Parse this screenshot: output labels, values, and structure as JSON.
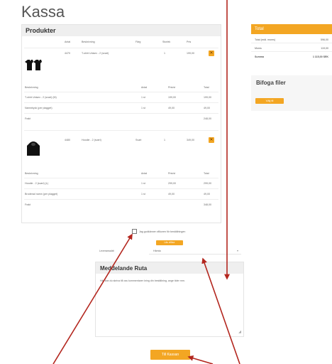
{
  "page": {
    "title": "Kassa"
  },
  "products": {
    "title": "Produkter",
    "headers": [
      "Antal",
      "Beskrivning",
      "Färg",
      "Storlek",
      "Pris"
    ],
    "items": [
      {
        "thumb": "tshirts-icon",
        "row": [
          "4470",
          "T-shirt Unisex - 2 (svart)",
          "",
          "1",
          "199,00"
        ],
        "sub_headers": [
          "Beskrivning",
          "Antal",
          "Pris/st",
          "Total"
        ],
        "sub_rows": [
          [
            "T-shirt Unisex - 2 (svart) (M)",
            "1 st",
            "199,00",
            "199,00"
          ],
          [
            "Namntryck (per plagget)",
            "1 st",
            "49,00",
            "49,00"
          ],
          [
            "Frakt",
            "",
            "",
            "248,00"
          ]
        ]
      },
      {
        "thumb": "hoodie-icon",
        "row": [
          "4480",
          "Hoodie - 2 (svart)",
          "Svart",
          "1",
          "349,00"
        ],
        "sub_headers": [
          "Beskrivning",
          "Antal",
          "Pris/st",
          "Total"
        ],
        "sub_rows": [
          [
            "Hoodie - 2 (svart) (L)",
            "1 st",
            "299,00",
            "299,00"
          ],
          [
            "Broderad namn (per plagget)",
            "1 st",
            "49,00",
            "49,00"
          ],
          [
            "Frakt",
            "",
            "",
            "348,00"
          ]
        ]
      }
    ]
  },
  "total": {
    "title": "Total",
    "rows": [
      [
        "Total (exkl. moms)",
        "596,00"
      ],
      [
        "Moms",
        "119,00"
      ],
      [
        "Summa",
        "1 115,00 SEK"
      ]
    ]
  },
  "attach": {
    "title": "Bifoga filer",
    "button": "Välj fil"
  },
  "terms": {
    "label": "Jag godkänner villkoren för beställningen",
    "button": "Läs villkor"
  },
  "delivery": {
    "label": "Leveranssätt",
    "value": "Hämta"
  },
  "message": {
    "title": "Meddelande Ruta",
    "text": "Här kan du skriva till oss kommentarer kring din beställning, ange tider mm."
  },
  "next_button": "Till Kassan",
  "colors": {
    "accent": "#f3a623",
    "arrow": "#b3261e"
  }
}
